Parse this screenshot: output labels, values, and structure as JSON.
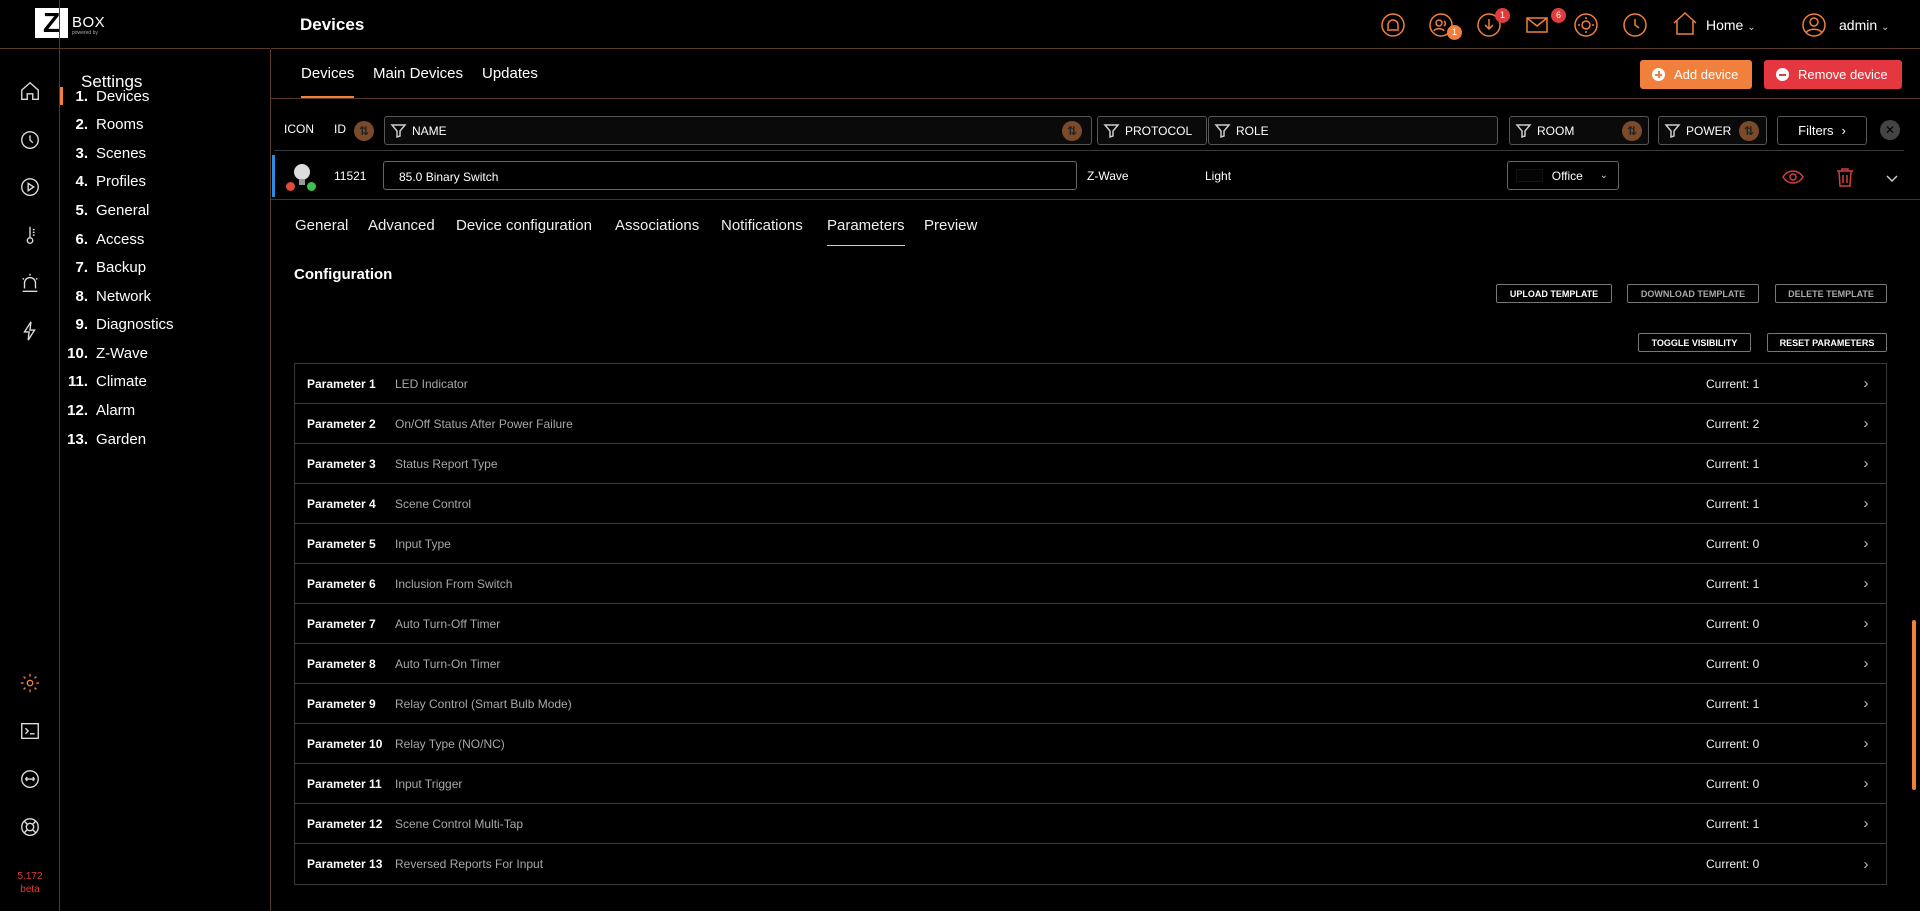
{
  "app": {
    "logo_text": "BOX",
    "logo_sub": "powered by",
    "version": "5.172",
    "version_tag": "beta"
  },
  "header": {
    "title": "Devices",
    "home_label": "Home",
    "user_label": "admin",
    "badges": {
      "users": "1",
      "download": "1",
      "mail": "6"
    }
  },
  "settings": {
    "title": "Settings",
    "items": [
      {
        "num": "1.",
        "label": "Devices"
      },
      {
        "num": "2.",
        "label": "Rooms"
      },
      {
        "num": "3.",
        "label": "Scenes"
      },
      {
        "num": "4.",
        "label": "Profiles"
      },
      {
        "num": "5.",
        "label": "General"
      },
      {
        "num": "6.",
        "label": "Access"
      },
      {
        "num": "7.",
        "label": "Backup"
      },
      {
        "num": "8.",
        "label": "Network"
      },
      {
        "num": "9.",
        "label": "Diagnostics"
      },
      {
        "num": "10.",
        "label": "Z-Wave"
      },
      {
        "num": "11.",
        "label": "Climate"
      },
      {
        "num": "12.",
        "label": "Alarm"
      },
      {
        "num": "13.",
        "label": "Garden"
      }
    ]
  },
  "subnav": {
    "tabs": [
      "Devices",
      "Main Devices",
      "Updates"
    ],
    "add_device": "Add device",
    "remove_device": "Remove device"
  },
  "filterbar": {
    "icon": "ICON",
    "id": "ID",
    "name": "NAME",
    "protocol": "PROTOCOL",
    "role": "ROLE",
    "room": "ROOM",
    "power": "POWER",
    "filters": "Filters"
  },
  "device": {
    "id": "11521",
    "name": "85.0 Binary Switch",
    "protocol": "Z-Wave",
    "role": "Light",
    "room": "Office"
  },
  "detail_tabs": [
    "General",
    "Advanced",
    "Device configuration",
    "Associations",
    "Notifications",
    "Parameters",
    "Preview"
  ],
  "config": {
    "title": "Configuration",
    "upload": "UPLOAD TEMPLATE",
    "download": "DOWNLOAD TEMPLATE",
    "delete": "DELETE TEMPLATE",
    "toggle": "TOGGLE VISIBILITY",
    "reset": "RESET PARAMETERS"
  },
  "parameters": [
    {
      "name": "Parameter 1",
      "desc": "LED Indicator",
      "current": "Current: 1"
    },
    {
      "name": "Parameter 2",
      "desc": "On/Off Status After Power Failure",
      "current": "Current: 2"
    },
    {
      "name": "Parameter 3",
      "desc": "Status Report Type",
      "current": "Current: 1"
    },
    {
      "name": "Parameter 4",
      "desc": "Scene Control",
      "current": "Current: 1"
    },
    {
      "name": "Parameter 5",
      "desc": "Input Type",
      "current": "Current: 0"
    },
    {
      "name": "Parameter 6",
      "desc": "Inclusion From Switch",
      "current": "Current: 1"
    },
    {
      "name": "Parameter 7",
      "desc": "Auto Turn-Off Timer",
      "current": "Current: 0"
    },
    {
      "name": "Parameter 8",
      "desc": "Auto Turn-On Timer",
      "current": "Current: 0"
    },
    {
      "name": "Parameter 9",
      "desc": "Relay Control (Smart Bulb Mode)",
      "current": "Current: 1"
    },
    {
      "name": "Parameter 10",
      "desc": "Relay Type (NO/NC)",
      "current": "Current: 0"
    },
    {
      "name": "Parameter 11",
      "desc": "Input Trigger",
      "current": "Current: 0"
    },
    {
      "name": "Parameter 12",
      "desc": "Scene Control Multi-Tap",
      "current": "Current: 1"
    },
    {
      "name": "Parameter 13",
      "desc": "Reversed Reports For Input",
      "current": "Current: 0"
    }
  ],
  "colors": {
    "accent": "#f0803c",
    "danger": "#e5373f",
    "selected_bar": "#2a8de0"
  }
}
